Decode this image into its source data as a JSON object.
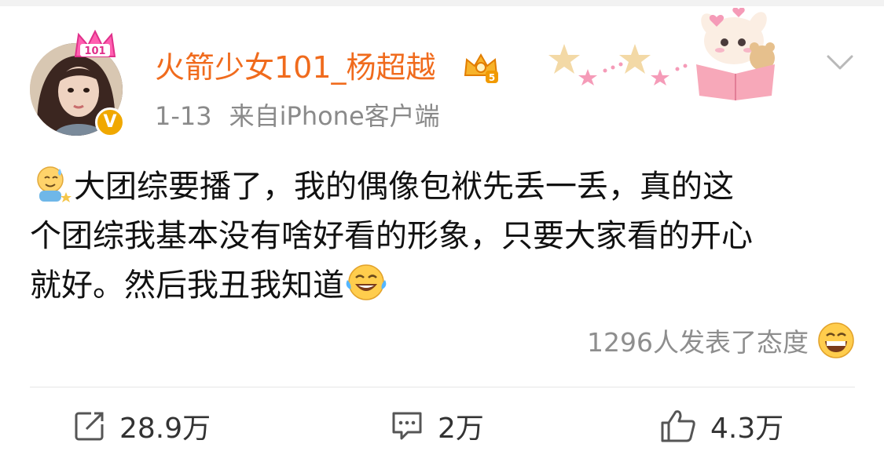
{
  "post": {
    "username": "火箭少女101_杨超越",
    "date": "1-13",
    "source": "来自iPhone客户端",
    "text_lines": [
      "大团综要播了，我的偶像包袱先丢一丢，真的这",
      "个团综我基本没有啥好看的形象，只要大家看的开心",
      "就好。然后我丑我知道"
    ],
    "reactions_text": "1296人发表了态度"
  },
  "actions": {
    "repost_count": "28.9万",
    "comment_count": "2万",
    "like_count": "4.3万"
  },
  "icons": {
    "crown": "pink-crown-101-icon",
    "verified": "verified-v-icon",
    "vip": "vip-crown-level-icon",
    "more": "chevron-down-icon",
    "emoji_start": "sweat-smile-emoji",
    "emoji_end": "laugh-cry-emoji",
    "reaction": "grin-emoji",
    "repost": "repost-icon",
    "comment": "comment-icon",
    "like": "thumbs-up-icon"
  },
  "badge_text": {
    "crown_number": "101",
    "verified_letter": "V",
    "vip_level": "5"
  },
  "colors": {
    "username": "#f06b1d",
    "meta": "#8a8a8a",
    "text": "#111111",
    "verified": "#f0a800"
  }
}
